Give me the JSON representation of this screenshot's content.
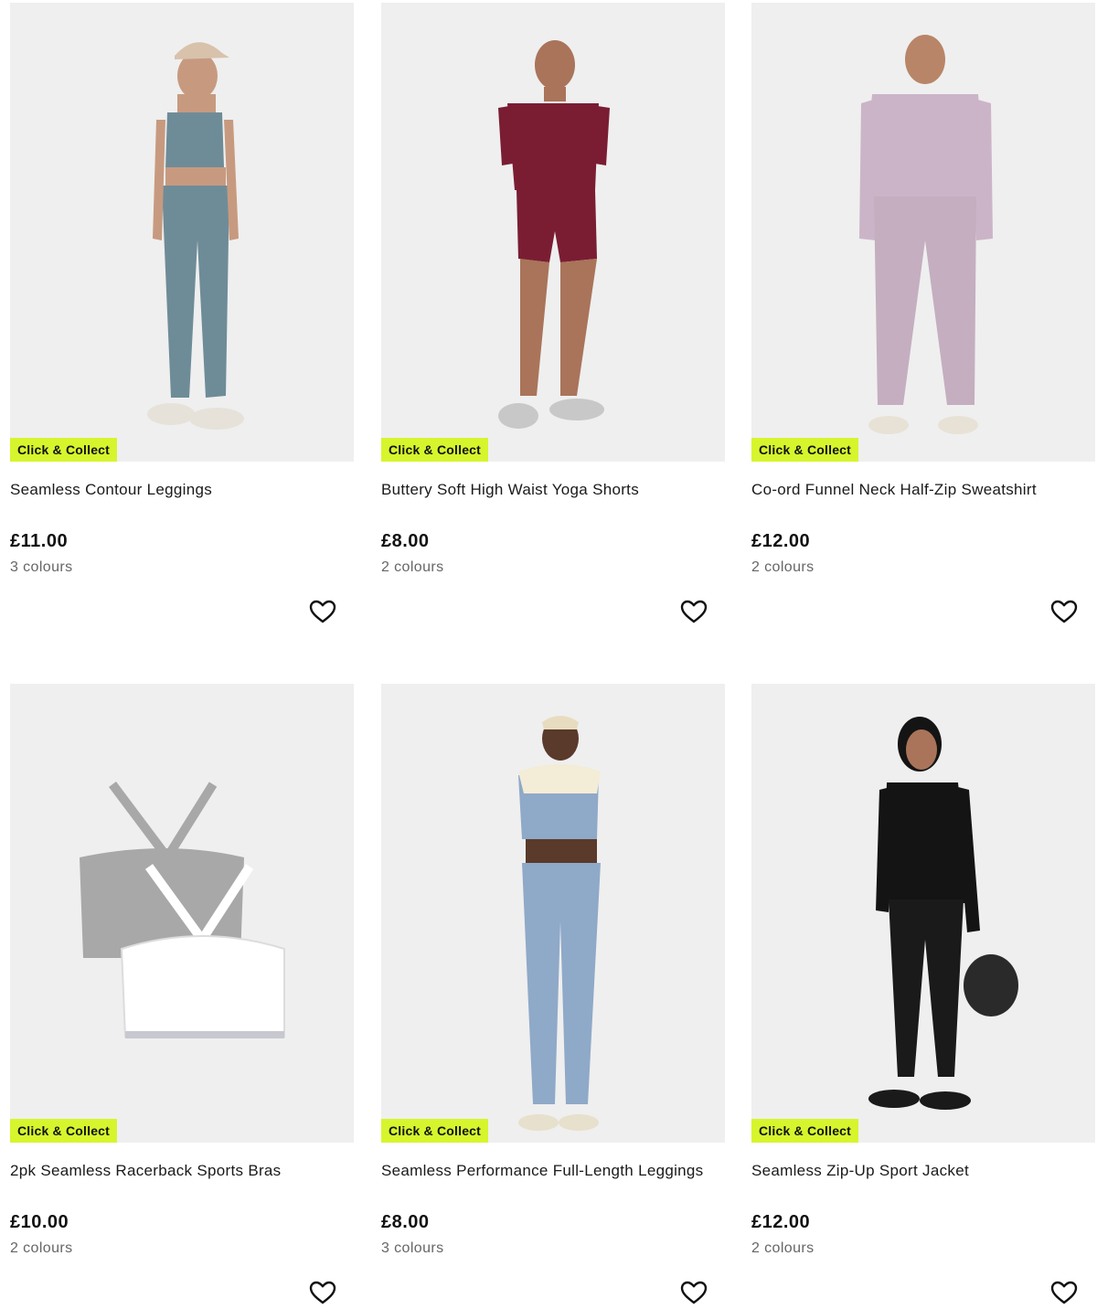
{
  "badge_color": "#d7f52d",
  "products": [
    {
      "badge": "Click & Collect",
      "title": "Seamless Contour Leggings",
      "price": "£11.00",
      "colours": "3 colours",
      "icon": "heart-outline-icon",
      "garment_color": "#6e8c98"
    },
    {
      "badge": "Click & Collect",
      "title": "Buttery Soft High Waist Yoga Shorts",
      "price": "£8.00",
      "colours": "2 colours",
      "icon": "heart-outline-icon",
      "garment_color": "#7a1d33"
    },
    {
      "badge": "Click & Collect",
      "title": "Co-ord Funnel Neck Half-Zip Sweatshirt",
      "price": "£12.00",
      "colours": "2 colours",
      "icon": "heart-outline-icon",
      "garment_color": "#cbb4c8"
    },
    {
      "badge": "Click & Collect",
      "title": "2pk Seamless Racerback Sports Bras",
      "price": "£10.00",
      "colours": "2 colours",
      "icon": "heart-outline-icon",
      "garment_color": "#a8a8a8"
    },
    {
      "badge": "Click & Collect",
      "title": "Seamless Performance Full-Length Leggings",
      "price": "£8.00",
      "colours": "3 colours",
      "icon": "heart-outline-icon",
      "garment_color": "#8fa9c8"
    },
    {
      "badge": "Click & Collect",
      "title": "Seamless Zip-Up Sport Jacket",
      "price": "£12.00",
      "colours": "2 colours",
      "icon": "heart-outline-icon",
      "garment_color": "#141414"
    }
  ]
}
